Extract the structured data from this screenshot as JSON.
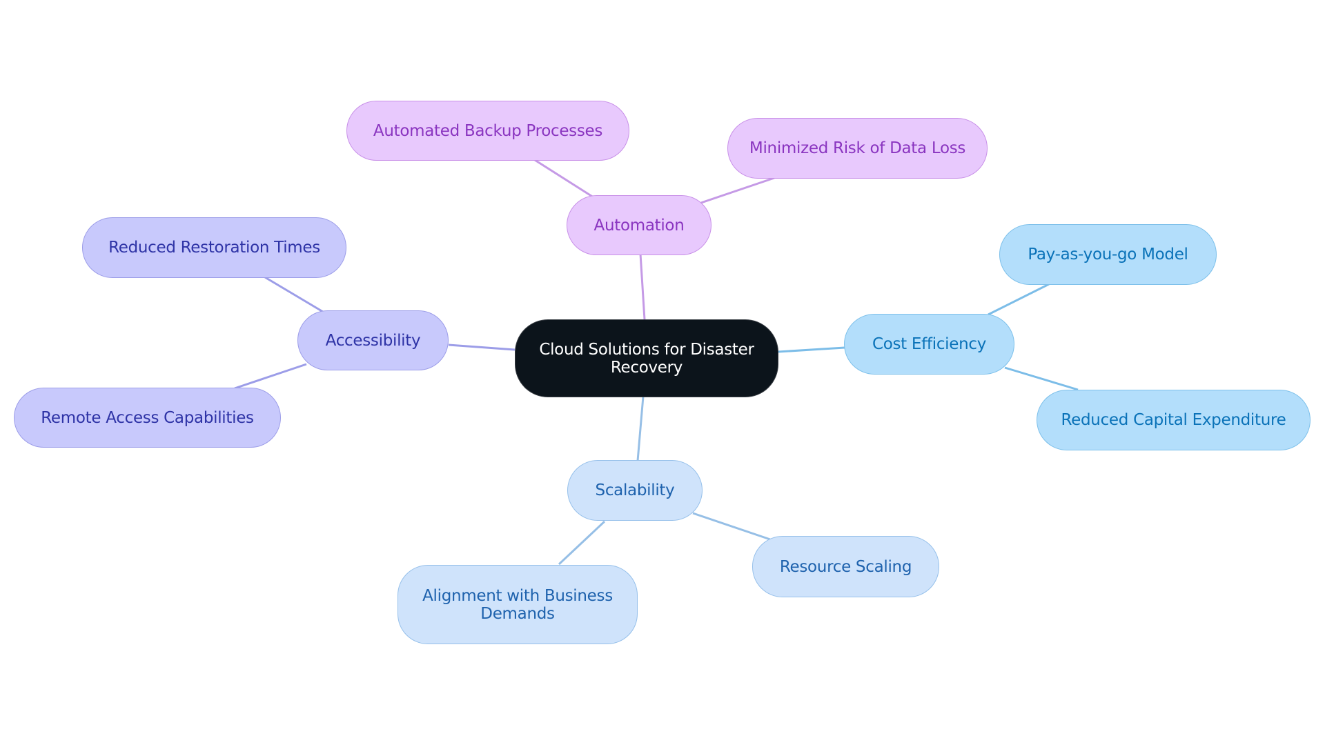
{
  "root": {
    "label": "Cloud Solutions for Disaster Recovery"
  },
  "branches": [
    {
      "label": "Automation",
      "theme": "purple",
      "edge_color": "#c59ae6",
      "children": [
        {
          "label": "Automated Backup Processes"
        },
        {
          "label": "Minimized Risk of Data Loss"
        }
      ]
    },
    {
      "label": "Accessibility",
      "theme": "indigo",
      "edge_color": "#9c9de8",
      "children": [
        {
          "label": "Reduced Restoration Times"
        },
        {
          "label": "Remote Access Capabilities"
        }
      ]
    },
    {
      "label": "Cost Efficiency",
      "theme": "sky",
      "edge_color": "#7cbde8",
      "children": [
        {
          "label": "Pay-as-you-go Model"
        },
        {
          "label": "Reduced Capital Expenditure"
        }
      ]
    },
    {
      "label": "Scalability",
      "theme": "pale",
      "edge_color": "#96bfe6",
      "children": [
        {
          "label": "Alignment with Business Demands"
        },
        {
          "label": "Resource Scaling"
        }
      ]
    }
  ]
}
